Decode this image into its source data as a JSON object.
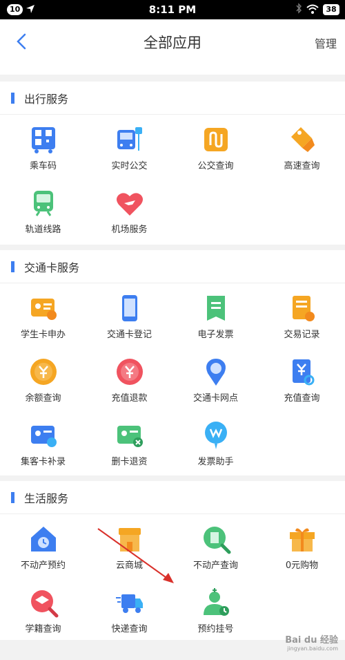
{
  "statusbar": {
    "notification_count": "10",
    "time": "8:11 PM",
    "battery": "38"
  },
  "header": {
    "title": "全部应用",
    "manage_label": "管理"
  },
  "sections": [
    {
      "title": "出行服务",
      "items": [
        {
          "label": "乘车码",
          "icon": "qr-code-icon"
        },
        {
          "label": "实时公交",
          "icon": "bus-icon"
        },
        {
          "label": "公交查询",
          "icon": "route-icon"
        },
        {
          "label": "高速查询",
          "icon": "highway-tag-icon"
        },
        {
          "label": "轨道线路",
          "icon": "metro-train-icon"
        },
        {
          "label": "机场服务",
          "icon": "airplane-heart-icon"
        }
      ]
    },
    {
      "title": "交通卡服务",
      "items": [
        {
          "label": "学生卡申办",
          "icon": "student-card-icon"
        },
        {
          "label": "交通卡登记",
          "icon": "phone-card-icon"
        },
        {
          "label": "电子发票",
          "icon": "e-invoice-icon"
        },
        {
          "label": "交易记录",
          "icon": "transaction-record-icon"
        },
        {
          "label": "余额查询",
          "icon": "balance-coin-icon"
        },
        {
          "label": "充值退款",
          "icon": "refund-icon"
        },
        {
          "label": "交通卡网点",
          "icon": "location-pin-icon"
        },
        {
          "label": "充值查询",
          "icon": "recharge-search-icon"
        },
        {
          "label": "集客卡补录",
          "icon": "card-supplement-icon"
        },
        {
          "label": "删卡退资",
          "icon": "delete-card-icon"
        },
        {
          "label": "发票助手",
          "icon": "invoice-assistant-icon"
        }
      ]
    },
    {
      "title": "生活服务",
      "items": [
        {
          "label": "不动产预约",
          "icon": "house-clock-icon"
        },
        {
          "label": "云商城",
          "icon": "shop-icon"
        },
        {
          "label": "不动产查询",
          "icon": "building-search-icon"
        },
        {
          "label": "0元购物",
          "icon": "gift-icon"
        },
        {
          "label": "学籍查询",
          "icon": "graduation-cap-icon"
        },
        {
          "label": "快递查询",
          "icon": "delivery-truck-icon"
        },
        {
          "label": "预约挂号",
          "icon": "doctor-appointment-icon"
        }
      ]
    }
  ],
  "watermark": {
    "brand": "Bai du 经验",
    "url": "jingyan.baidu.com"
  },
  "colors": {
    "accent": "#3d7ef0",
    "background": "#f2f2f2",
    "annotation_arrow": "#d9312b"
  }
}
